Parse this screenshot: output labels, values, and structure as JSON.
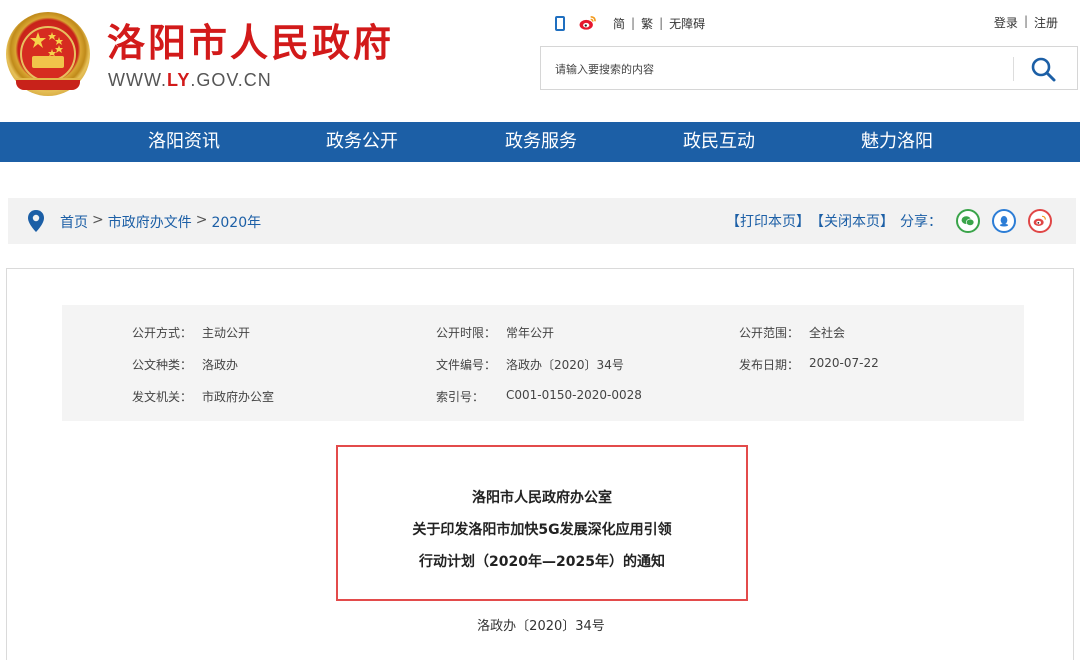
{
  "header": {
    "site_name": "洛阳市人民政府",
    "site_url_prefix": "WWW.",
    "site_url_highlight": "LY",
    "site_url_suffix": ".GOV.CN",
    "toolbar": {
      "simplified": "简",
      "traditional": "繁",
      "accessibility": "无障碍",
      "separator": "|"
    },
    "auth": {
      "login": "登录",
      "register": "注册",
      "separator": "|"
    },
    "search": {
      "placeholder": "请输入要搜索的内容"
    }
  },
  "nav": {
    "items": [
      {
        "label": "洛阳资讯"
      },
      {
        "label": "政务公开"
      },
      {
        "label": "政务服务"
      },
      {
        "label": "政民互动"
      },
      {
        "label": "魅力洛阳"
      }
    ]
  },
  "breadcrumb": {
    "items": [
      "首页",
      "市政府办文件",
      "2020年"
    ],
    "separator": ">"
  },
  "actions": {
    "print": "【打印本页】",
    "close": "【关闭本页】",
    "share": "分享："
  },
  "meta": {
    "rows": [
      [
        {
          "label": "公开方式：",
          "value": "主动公开"
        },
        {
          "label": "公开时限：",
          "value": "常年公开"
        },
        {
          "label": "公开范围：",
          "value": "全社会"
        }
      ],
      [
        {
          "label": "公文种类：",
          "value": "洛政办"
        },
        {
          "label": "文件编号：",
          "value": "洛政办〔2020〕34号"
        },
        {
          "label": "发布日期：",
          "value": "2020-07-22"
        }
      ],
      [
        {
          "label": "发文机关：",
          "value": "市政府办公室"
        },
        {
          "label": "索引号：",
          "value": "C001-0150-2020-0028"
        }
      ]
    ]
  },
  "document": {
    "title_lines": [
      "洛阳市人民政府办公室",
      "关于印发洛阳市加快5G发展深化应用引领",
      "行动计划（2020年—2025年）的通知"
    ],
    "number": "洛政办〔2020〕34号"
  },
  "colors": {
    "brand_red": "#d21a1a",
    "nav_blue": "#1c5fa6",
    "highlight_border": "#e34b4b"
  }
}
